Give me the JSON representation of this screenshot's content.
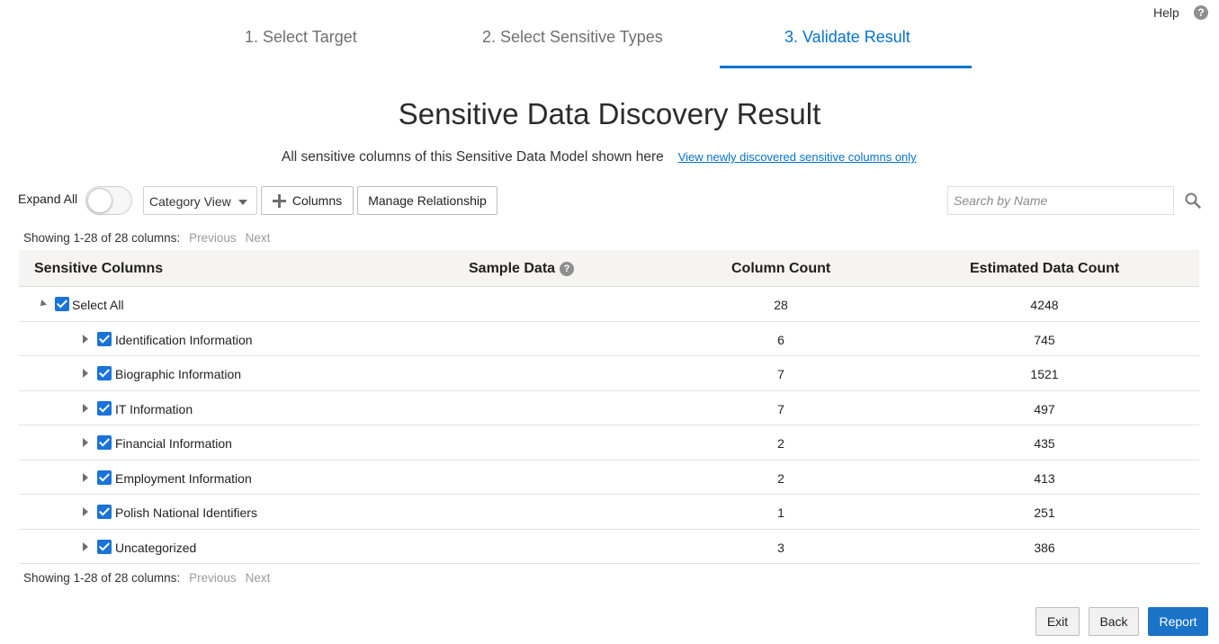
{
  "help": {
    "label": "Help",
    "icon": "question-circle-icon"
  },
  "train": {
    "steps": [
      {
        "label": "1. Select Target",
        "state": "visited"
      },
      {
        "label": "2. Select Sensitive Types",
        "state": "visited"
      },
      {
        "label": "3. Validate Result",
        "state": "current"
      }
    ],
    "active_color": "#0572ce"
  },
  "page": {
    "title": "Sensitive Data Discovery Result",
    "subtitle": "All sensitive columns of this Sensitive Data Model shown here",
    "view_new_link": "View newly discovered sensitive columns only"
  },
  "toolbar": {
    "expand_all_label": "Expand All",
    "expand_all_on": false,
    "view_select": "Category View",
    "columns_button": "Columns",
    "manage_button": "Manage Relationship",
    "search_placeholder": "Search by Name"
  },
  "pager": {
    "showing": "Showing 1-28 of 28 columns:",
    "previous": "Previous",
    "next": "Next"
  },
  "table": {
    "headers": {
      "sensitive_columns": "Sensitive Columns",
      "sample_data": "Sample Data",
      "column_count": "Column Count",
      "estimated_data_count": "Estimated Data Count"
    },
    "root": {
      "label": "Select All",
      "checked": true,
      "expanded": true,
      "column_count": "28",
      "data_count": "4248"
    },
    "rows": [
      {
        "label": "Identification Information",
        "checked": true,
        "column_count": "6",
        "data_count": "745"
      },
      {
        "label": "Biographic Information",
        "checked": true,
        "column_count": "7",
        "data_count": "1521"
      },
      {
        "label": "IT Information",
        "checked": true,
        "column_count": "7",
        "data_count": "497"
      },
      {
        "label": "Financial Information",
        "checked": true,
        "column_count": "2",
        "data_count": "435"
      },
      {
        "label": "Employment Information",
        "checked": true,
        "column_count": "2",
        "data_count": "413"
      },
      {
        "label": "Polish National Identifiers",
        "checked": true,
        "column_count": "1",
        "data_count": "251"
      },
      {
        "label": "Uncategorized",
        "checked": true,
        "column_count": "3",
        "data_count": "386"
      }
    ]
  },
  "footer": {
    "exit": "Exit",
    "back": "Back",
    "report": "Report",
    "report_color": "#1a73c7"
  }
}
